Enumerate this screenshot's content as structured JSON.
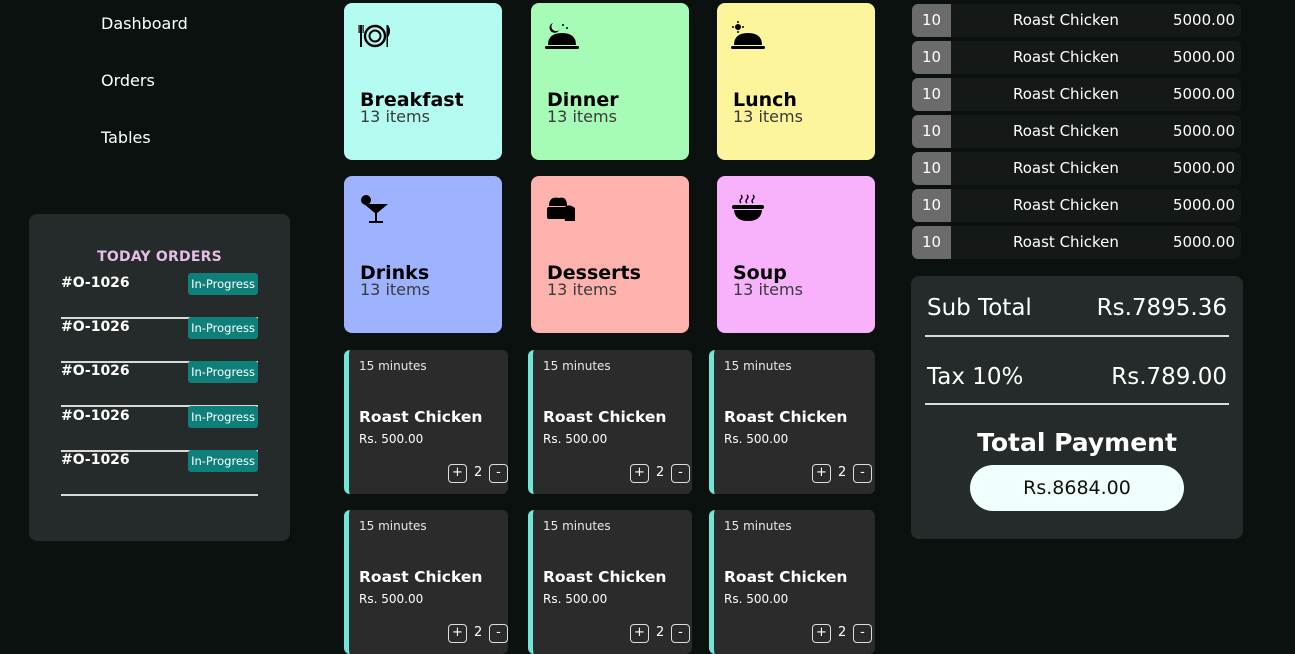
{
  "nav": {
    "dashboard": "Dashboard",
    "orders": "Orders",
    "tables": "Tables"
  },
  "today_orders": {
    "title": "TODAY ORDERS",
    "items": [
      {
        "id": "#O-1026",
        "status": "In-Progress"
      },
      {
        "id": "#O-1026",
        "status": "In-Progress"
      },
      {
        "id": "#O-1026",
        "status": "In-Progress"
      },
      {
        "id": "#O-1026",
        "status": "In-Progress"
      },
      {
        "id": "#O-1026",
        "status": "In-Progress"
      }
    ]
  },
  "categories": [
    {
      "name": "Breakfast",
      "count": "13 items",
      "icon": "plate-cutlery-icon",
      "color": "#b4fcf1"
    },
    {
      "name": "Dinner",
      "count": "13 items",
      "icon": "cloche-moon-icon",
      "color": "#a6fbb6"
    },
    {
      "name": "Lunch",
      "count": "13 items",
      "icon": "cloche-sun-icon",
      "color": "#fdf59c"
    },
    {
      "name": "Drinks",
      "count": "13 items",
      "icon": "cocktail-icon",
      "color": "#9eb3ff"
    },
    {
      "name": "Desserts",
      "count": "13 items",
      "icon": "cake-icon",
      "color": "#fdb2ad"
    },
    {
      "name": "Soup",
      "count": "13 items",
      "icon": "soup-bowl-icon",
      "color": "#f8b2fc"
    }
  ],
  "menu_items": [
    {
      "time": "15 minutes",
      "name": "Roast Chicken",
      "price": "Rs. 500.00",
      "qty": "2",
      "plus": "+",
      "minus": "-"
    },
    {
      "time": "15 minutes",
      "name": "Roast Chicken",
      "price": "Rs. 500.00",
      "qty": "2",
      "plus": "+",
      "minus": "-"
    },
    {
      "time": "15 minutes",
      "name": "Roast Chicken",
      "price": "Rs. 500.00",
      "qty": "2",
      "plus": "+",
      "minus": "-"
    },
    {
      "time": "15 minutes",
      "name": "Roast Chicken",
      "price": "Rs. 500.00",
      "qty": "2",
      "plus": "+",
      "minus": "-"
    },
    {
      "time": "15 minutes",
      "name": "Roast Chicken",
      "price": "Rs. 500.00",
      "qty": "2",
      "plus": "+",
      "minus": "-"
    },
    {
      "time": "15 minutes",
      "name": "Roast Chicken",
      "price": "Rs. 500.00",
      "qty": "2",
      "plus": "+",
      "minus": "-"
    }
  ],
  "bill_rows": [
    {
      "qty": "10",
      "name": "Roast Chicken",
      "amount": "5000.00"
    },
    {
      "qty": "10",
      "name": "Roast Chicken",
      "amount": "5000.00"
    },
    {
      "qty": "10",
      "name": "Roast Chicken",
      "amount": "5000.00"
    },
    {
      "qty": "10",
      "name": "Roast Chicken",
      "amount": "5000.00"
    },
    {
      "qty": "10",
      "name": "Roast Chicken",
      "amount": "5000.00"
    },
    {
      "qty": "10",
      "name": "Roast Chicken",
      "amount": "5000.00"
    },
    {
      "qty": "10",
      "name": "Roast Chicken",
      "amount": "5000.00"
    }
  ],
  "summary": {
    "subtotal_label": "Sub Total",
    "subtotal_value": "Rs.7895.36",
    "tax_label": "Tax 10%",
    "tax_value": "Rs.789.00",
    "total_label": "Total Payment",
    "total_value": "Rs.8684.00"
  },
  "colors": {
    "accent": "#6fe6d7",
    "badge": "#0f7f7a",
    "panel": "#242b2a",
    "background": "#0b110f"
  }
}
